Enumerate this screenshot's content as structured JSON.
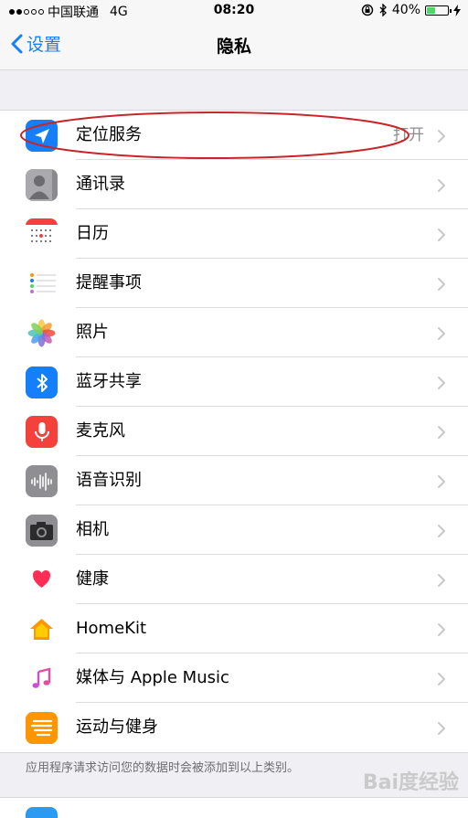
{
  "status_bar": {
    "carrier": "中国联通",
    "network": "4G",
    "time": "08:20",
    "battery": "40%",
    "battery_level": 0.4
  },
  "nav": {
    "back_label": "设置",
    "title": "隐私"
  },
  "items": [
    {
      "label": "定位服务",
      "value": "打开",
      "icon": "location-arrow-icon",
      "color": "#147efb"
    },
    {
      "label": "通讯录",
      "value": "",
      "icon": "contacts-icon",
      "color": "#9a9a9f"
    },
    {
      "label": "日历",
      "value": "",
      "icon": "calendar-icon",
      "color": "#ffffff"
    },
    {
      "label": "提醒事项",
      "value": "",
      "icon": "reminders-icon",
      "color": "#ffffff"
    },
    {
      "label": "照片",
      "value": "",
      "icon": "photos-icon",
      "color": "#ffffff"
    },
    {
      "label": "蓝牙共享",
      "value": "",
      "icon": "bluetooth-icon",
      "color": "#147efb"
    },
    {
      "label": "麦克风",
      "value": "",
      "icon": "microphone-icon",
      "color": "#f5413c"
    },
    {
      "label": "语音识别",
      "value": "",
      "icon": "speech-recognition-icon",
      "color": "#8e8e93"
    },
    {
      "label": "相机",
      "value": "",
      "icon": "camera-icon",
      "color": "#8e8e93"
    },
    {
      "label": "健康",
      "value": "",
      "icon": "health-heart-icon",
      "color": "#ffffff"
    },
    {
      "label": "HomeKit",
      "value": "",
      "icon": "homekit-icon",
      "color": "#ffffff"
    },
    {
      "label": "媒体与 Apple Music",
      "value": "",
      "icon": "music-note-icon",
      "color": "#ffffff"
    },
    {
      "label": "运动与健身",
      "value": "",
      "icon": "motion-fitness-icon",
      "color": "#ff9500"
    }
  ],
  "footer": "应用程序请求访问您的数据时会被添加到以上类别。",
  "watermark": "Bai度经验"
}
